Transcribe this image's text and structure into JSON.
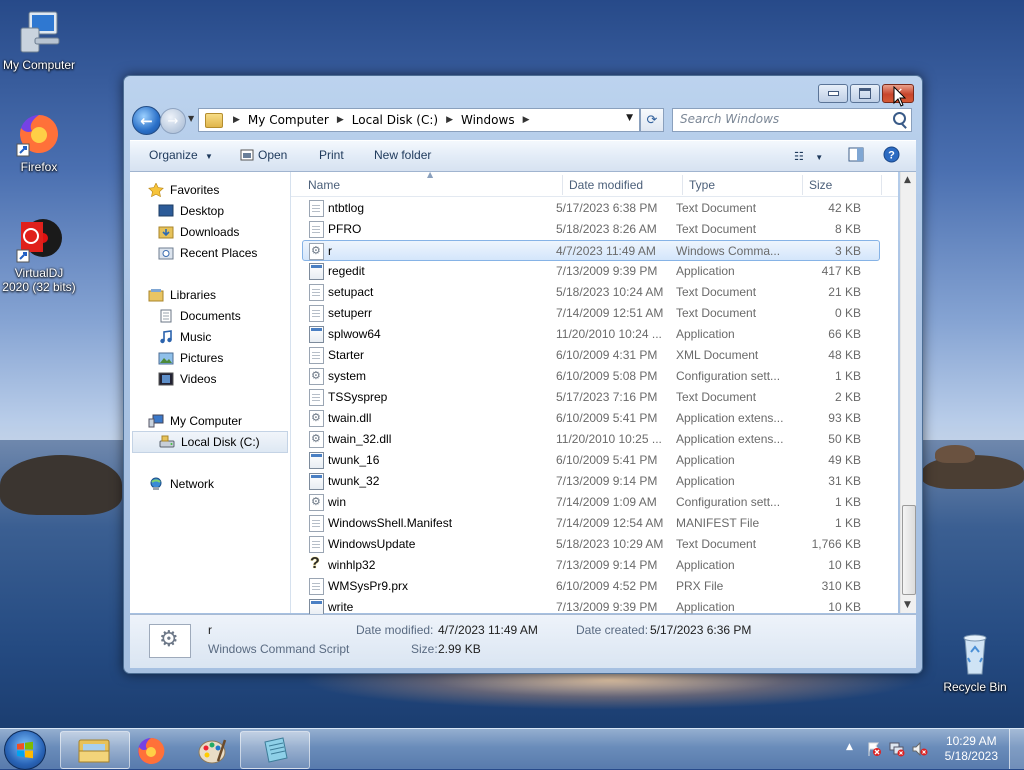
{
  "desktop": {
    "icons": [
      {
        "label": "My Computer"
      },
      {
        "label": "Firefox"
      },
      {
        "label": "VirtualDJ 2020 (32 bits)"
      },
      {
        "label": "Recycle Bin"
      }
    ]
  },
  "window": {
    "address": {
      "crumbs": [
        "My Computer",
        "Local Disk (C:)",
        "Windows"
      ]
    },
    "search": {
      "placeholder": "Search Windows"
    },
    "toolbar": {
      "organize": "Organize",
      "open": "Open",
      "print": "Print",
      "new_folder": "New folder"
    },
    "nav": {
      "favorites": "Favorites",
      "desktop": "Desktop",
      "downloads": "Downloads",
      "recent": "Recent Places",
      "libraries": "Libraries",
      "documents": "Documents",
      "music": "Music",
      "pictures": "Pictures",
      "videos": "Videos",
      "my_computer": "My Computer",
      "local_disk": "Local Disk (C:)",
      "network": "Network"
    },
    "columns": {
      "name": "Name",
      "date": "Date modified",
      "type": "Type",
      "size": "Size"
    },
    "files": [
      {
        "name": "ntbtlog",
        "date": "5/17/2023 6:38 PM",
        "type": "Text Document",
        "size": "42 KB",
        "icon": "doc"
      },
      {
        "name": "PFRO",
        "date": "5/18/2023 8:26 AM",
        "type": "Text Document",
        "size": "8 KB",
        "icon": "doc"
      },
      {
        "name": "r",
        "date": "4/7/2023 11:49 AM",
        "type": "Windows Comma...",
        "size": "3 KB",
        "icon": "gear",
        "selected": true
      },
      {
        "name": "regedit",
        "date": "7/13/2009 9:39 PM",
        "type": "Application",
        "size": "417 KB",
        "icon": "app"
      },
      {
        "name": "setupact",
        "date": "5/18/2023 10:24 AM",
        "type": "Text Document",
        "size": "21 KB",
        "icon": "doc"
      },
      {
        "name": "setuperr",
        "date": "7/14/2009 12:51 AM",
        "type": "Text Document",
        "size": "0 KB",
        "icon": "doc"
      },
      {
        "name": "splwow64",
        "date": "11/20/2010 10:24 ...",
        "type": "Application",
        "size": "66 KB",
        "icon": "app"
      },
      {
        "name": "Starter",
        "date": "6/10/2009 4:31 PM",
        "type": "XML Document",
        "size": "48 KB",
        "icon": "doc"
      },
      {
        "name": "system",
        "date": "6/10/2009 5:08 PM",
        "type": "Configuration sett...",
        "size": "1 KB",
        "icon": "gear"
      },
      {
        "name": "TSSysprep",
        "date": "5/17/2023 7:16 PM",
        "type": "Text Document",
        "size": "2 KB",
        "icon": "doc"
      },
      {
        "name": "twain.dll",
        "date": "6/10/2009 5:41 PM",
        "type": "Application extens...",
        "size": "93 KB",
        "icon": "gear"
      },
      {
        "name": "twain_32.dll",
        "date": "11/20/2010 10:25 ...",
        "type": "Application extens...",
        "size": "50 KB",
        "icon": "gear"
      },
      {
        "name": "twunk_16",
        "date": "6/10/2009 5:41 PM",
        "type": "Application",
        "size": "49 KB",
        "icon": "app"
      },
      {
        "name": "twunk_32",
        "date": "7/13/2009 9:14 PM",
        "type": "Application",
        "size": "31 KB",
        "icon": "app"
      },
      {
        "name": "win",
        "date": "7/14/2009 1:09 AM",
        "type": "Configuration sett...",
        "size": "1 KB",
        "icon": "gear"
      },
      {
        "name": "WindowsShell.Manifest",
        "date": "7/14/2009 12:54 AM",
        "type": "MANIFEST File",
        "size": "1 KB",
        "icon": "doc"
      },
      {
        "name": "WindowsUpdate",
        "date": "5/18/2023 10:29 AM",
        "type": "Text Document",
        "size": "1,766 KB",
        "icon": "doc"
      },
      {
        "name": "winhlp32",
        "date": "7/13/2009 9:14 PM",
        "type": "Application",
        "size": "10 KB",
        "icon": "help"
      },
      {
        "name": "WMSysPr9.prx",
        "date": "6/10/2009 4:52 PM",
        "type": "PRX File",
        "size": "310 KB",
        "icon": "doc"
      },
      {
        "name": "write",
        "date": "7/13/2009 9:39 PM",
        "type": "Application",
        "size": "10 KB",
        "icon": "app"
      }
    ],
    "details": {
      "name": "r",
      "type": "Windows Command Script",
      "modified_label": "Date modified:",
      "modified_value": "4/7/2023 11:49 AM",
      "created_label": "Date created:",
      "created_value": "5/17/2023 6:36 PM",
      "size_label": "Size:",
      "size_value": "2.99 KB"
    }
  },
  "taskbar": {
    "time": "10:29 AM",
    "date": "5/18/2023"
  }
}
